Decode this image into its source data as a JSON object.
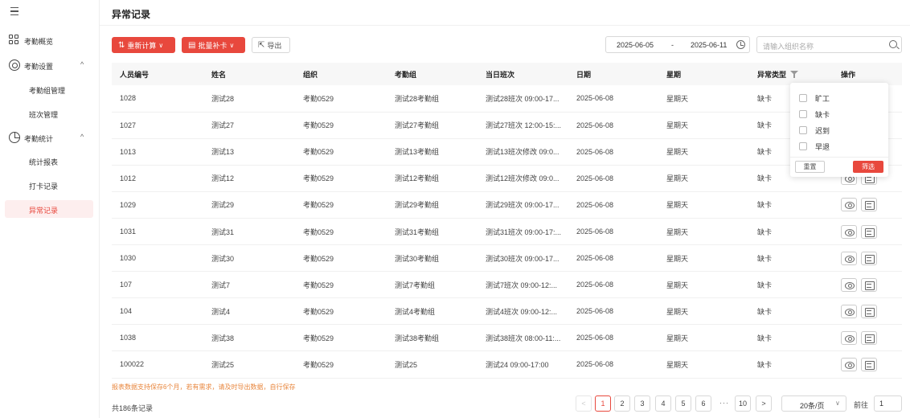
{
  "sidebar": {
    "items": [
      {
        "label": "考勤概览",
        "icon": "grid-icon"
      },
      {
        "label": "考勤设置",
        "icon": "gear-icon",
        "arrow": "^"
      },
      {
        "label": "考勤组管理"
      },
      {
        "label": "班次管理"
      },
      {
        "label": "考勤统计",
        "icon": "pie-chart-icon",
        "arrow": "^"
      },
      {
        "label": "统计报表"
      },
      {
        "label": "打卡记录"
      },
      {
        "label": "异常记录",
        "active": true
      }
    ]
  },
  "page": {
    "title": "异常记录"
  },
  "toolbar": {
    "recalc_label": "重新计算",
    "batch_label": "批量补卡",
    "export_label": "导出",
    "date_start": "2025-06-05",
    "date_sep": "-",
    "date_end": "2025-06-11",
    "search_placeholder": "请输入组织名称"
  },
  "table": {
    "columns": [
      "人员编号",
      "姓名",
      "组织",
      "考勤组",
      "当日班次",
      "日期",
      "星期",
      "异常类型",
      "操作"
    ],
    "rows": [
      [
        "1028",
        "测试28",
        "考勤0529",
        "测试28考勤组",
        "测试28班次 09:00-17...",
        "2025-06-08",
        "星期天",
        "缺卡"
      ],
      [
        "1027",
        "测试27",
        "考勤0529",
        "测试27考勤组",
        "测试27班次 12:00-15:...",
        "2025-06-08",
        "星期天",
        "缺卡"
      ],
      [
        "1013",
        "测试13",
        "考勤0529",
        "测试13考勤组",
        "测试13班次修改 09:0...",
        "2025-06-08",
        "星期天",
        "缺卡"
      ],
      [
        "1012",
        "测试12",
        "考勤0529",
        "测试12考勤组",
        "测试12班次修改 09:0...",
        "2025-06-08",
        "星期天",
        "缺卡"
      ],
      [
        "1029",
        "测试29",
        "考勤0529",
        "测试29考勤组",
        "测试29班次 09:00-17...",
        "2025-06-08",
        "星期天",
        "缺卡"
      ],
      [
        "1031",
        "测试31",
        "考勤0529",
        "测试31考勤组",
        "测试31班次 09:00-17:...",
        "2025-06-08",
        "星期天",
        "缺卡"
      ],
      [
        "1030",
        "测试30",
        "考勤0529",
        "测试30考勤组",
        "测试30班次 09:00-17...",
        "2025-06-08",
        "星期天",
        "缺卡"
      ],
      [
        "107",
        "测试7",
        "考勤0529",
        "测试7考勤组",
        "测试7班次 09:00-12:...",
        "2025-06-08",
        "星期天",
        "缺卡"
      ],
      [
        "104",
        "测试4",
        "考勤0529",
        "测试4考勤组",
        "测试4班次 09:00-12:...",
        "2025-06-08",
        "星期天",
        "缺卡"
      ],
      [
        "1038",
        "测试38",
        "考勤0529",
        "测试38考勤组",
        "测试38班次 08:00-11:...",
        "2025-06-08",
        "星期天",
        "缺卡"
      ],
      [
        "100022",
        "测试25",
        "考勤0529",
        "测试25",
        "测试24 09:00-17:00",
        "2025-06-08",
        "星期天",
        "缺卡"
      ]
    ]
  },
  "filter": {
    "options": [
      "旷工",
      "缺卡",
      "迟到",
      "早退"
    ],
    "reset_label": "重置",
    "confirm_label": "筛选"
  },
  "footer": {
    "notice": "报表数据支持保存6个月，若有需求，请及时导出数据，自行保存",
    "total": "共186条记录",
    "pages": [
      "1",
      "2",
      "3",
      "4",
      "5",
      "6",
      "10"
    ],
    "ellipsis": "···",
    "prev": "<",
    "next": ">",
    "page_size": "20条/页",
    "goto_label": "前往",
    "goto_value": "1"
  },
  "colors": {
    "accent": "#e8483d"
  }
}
